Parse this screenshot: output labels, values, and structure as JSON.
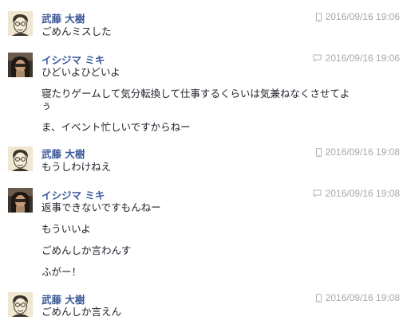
{
  "messages": [
    {
      "sender": "武藤 大樹",
      "time": "2016/09/16 19:06",
      "device": "mobile-icon",
      "lines": [
        "ごめんミスした"
      ]
    },
    {
      "sender": "イシジマ ミキ",
      "time": "2016/09/16 19:06",
      "device": "chat-icon",
      "lines": [
        "ひどいよひどいよ",
        "寝たりゲームして気分転換して仕事するくらいは気兼ねなくさせてよ",
        "ぅ",
        "ま、イベント忙しいですからねー"
      ]
    },
    {
      "sender": "武藤 大樹",
      "time": "2016/09/16 19:08",
      "device": "mobile-icon",
      "lines": [
        "もうしわけねえ"
      ]
    },
    {
      "sender": "イシジマ ミキ",
      "time": "2016/09/16 19:08",
      "device": "chat-icon",
      "lines": [
        "返事できないですもんねー",
        "もういいよ",
        "ごめんしか言わんす",
        "ふがー！"
      ]
    },
    {
      "sender": "武藤 大樹",
      "time": "2016/09/16 19:08",
      "device": "mobile-icon",
      "lines": [
        "ごめんしか言えん"
      ]
    }
  ]
}
